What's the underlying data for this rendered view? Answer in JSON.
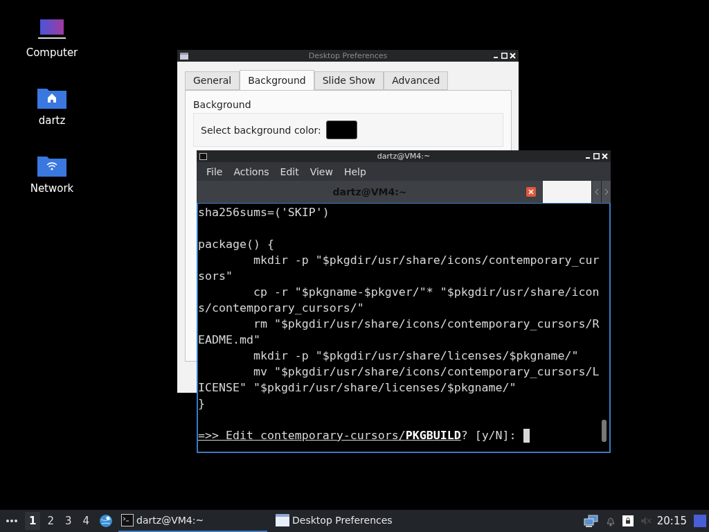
{
  "desktop_icons": [
    {
      "label": "Computer",
      "kind": "computer"
    },
    {
      "label": "dartz",
      "kind": "home"
    },
    {
      "label": "Network",
      "kind": "network"
    }
  ],
  "preferences_window": {
    "title": "Desktop Preferences",
    "tabs": [
      {
        "label": "General",
        "selected": false
      },
      {
        "label": "Background",
        "selected": true
      },
      {
        "label": "Slide Show",
        "selected": false
      },
      {
        "label": "Advanced",
        "selected": false
      }
    ],
    "group_title": "Background",
    "color_label": "Select background color:",
    "color": "#000000"
  },
  "terminal_window": {
    "title": "dartz@VM4:~",
    "menu": [
      "File",
      "Actions",
      "Edit",
      "View",
      "Help"
    ],
    "tab_label": "dartz@VM4:~",
    "lines": [
      {
        "kind": "code",
        "text": "sha256sums=('SKIP')"
      },
      {
        "kind": "blank"
      },
      {
        "kind": "code",
        "text": "package() {"
      },
      {
        "kind": "code",
        "text": "        mkdir -p \"$pkgdir/usr/share/icons/contemporary_cur"
      },
      {
        "kind": "code",
        "text": "sors\""
      },
      {
        "kind": "code",
        "text": "        cp -r \"$pkgname-$pkgver/\"* \"$pkgdir/usr/share/icon"
      },
      {
        "kind": "code",
        "text": "s/contemporary_cursors/\""
      },
      {
        "kind": "code",
        "text": "        rm \"$pkgdir/usr/share/icons/contemporary_cursors/R"
      },
      {
        "kind": "code",
        "text": "EADME.md\""
      },
      {
        "kind": "code",
        "text": "        mkdir -p \"$pkgdir/usr/share/licenses/$pkgname/\""
      },
      {
        "kind": "code",
        "text": "        mv \"$pkgdir/usr/share/icons/contemporary_cursors/L"
      },
      {
        "kind": "code",
        "text": "ICENSE\" \"$pkgdir/usr/share/licenses/$pkgname/\""
      },
      {
        "kind": "code",
        "text": "}"
      },
      {
        "kind": "blank"
      }
    ],
    "prompt": "=>> Edit contemporary-cursors/**PKGBUILD**",
    "prompt_suffix": "? [y/N]:"
  },
  "taskbar": {
    "workspaces": [
      {
        "label": "1",
        "selected": true
      },
      {
        "label": "2",
        "selected": false
      },
      {
        "label": "3",
        "selected": false
      },
      {
        "label": "4",
        "selected": false
      }
    ],
    "tasks": [
      {
        "label": "dartz@VM4:~",
        "kind": "terminal",
        "selected": true
      },
      {
        "label": "Desktop Preferences",
        "kind": "window",
        "selected": false
      }
    ],
    "clock": "20:15"
  }
}
